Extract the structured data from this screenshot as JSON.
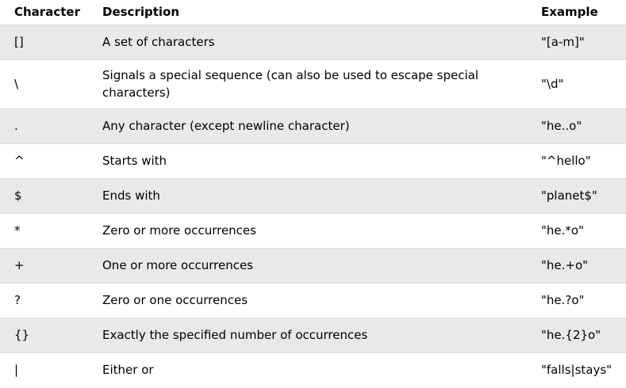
{
  "table": {
    "headers": [
      "Character",
      "Description",
      "Example"
    ],
    "rows": [
      {
        "character": "[]",
        "description": "A set of characters",
        "example": "\"[a-m]\""
      },
      {
        "character": "\\",
        "description": "Signals a special sequence (can also be used to escape special characters)",
        "example": "\"\\d\""
      },
      {
        "character": ".",
        "description": "Any character (except newline character)",
        "example": "\"he..o\""
      },
      {
        "character": "^",
        "description": "Starts with",
        "example": "\"^hello\""
      },
      {
        "character": "$",
        "description": "Ends with",
        "example": "\"planet$\""
      },
      {
        "character": "*",
        "description": "Zero or more occurrences",
        "example": "\"he.*o\""
      },
      {
        "character": "+",
        "description": "One or more occurrences",
        "example": "\"he.+o\""
      },
      {
        "character": "?",
        "description": "Zero or one occurrences",
        "example": "\"he.?o\""
      },
      {
        "character": "{}",
        "description": "Exactly the specified number of occurrences",
        "example": "\"he.{2}o\""
      },
      {
        "character": "|",
        "description": "Either or",
        "example": "\"falls|stays\""
      }
    ]
  },
  "colors": {
    "shaded_row": "#e7e9eb",
    "row_border": "#dddddd",
    "text": "#000000"
  }
}
